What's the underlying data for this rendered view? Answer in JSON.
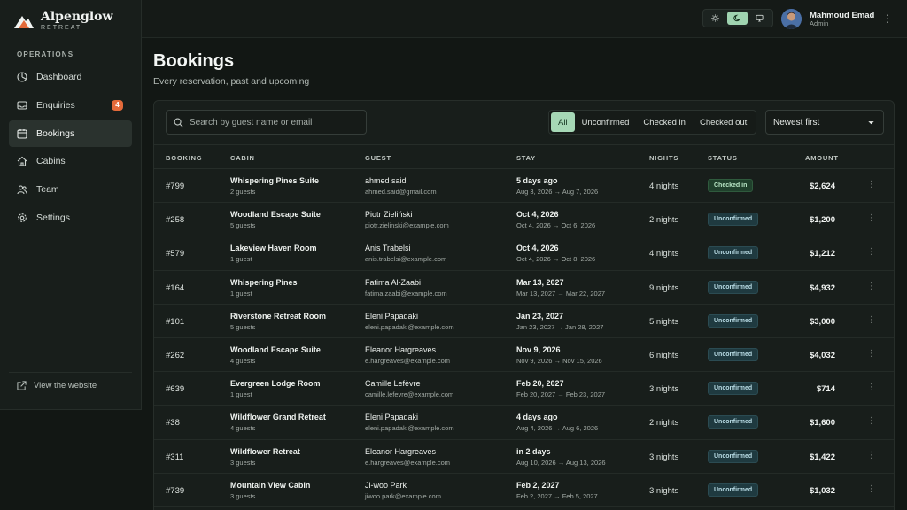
{
  "brand": {
    "name": "Alpenglow",
    "subtitle": "RETREAT"
  },
  "sidebar": {
    "section_label": "OPERATIONS",
    "items": [
      {
        "label": "Dashboard",
        "icon": "dashboard-icon"
      },
      {
        "label": "Enquiries",
        "icon": "inbox-icon",
        "badge": "4"
      },
      {
        "label": "Bookings",
        "icon": "calendar-icon",
        "active": true
      },
      {
        "label": "Cabins",
        "icon": "home-icon"
      },
      {
        "label": "Team",
        "icon": "users-icon"
      },
      {
        "label": "Settings",
        "icon": "gear-icon"
      }
    ],
    "view_site": "View the website"
  },
  "topbar": {
    "theme_options": [
      "sun-icon",
      "moon-icon",
      "monitor-icon"
    ],
    "theme_active": "moon-icon",
    "user_name": "Mahmoud Emad",
    "user_role": "Admin"
  },
  "page": {
    "title": "Bookings",
    "subtitle": "Every reservation, past and upcoming"
  },
  "toolbar": {
    "search_placeholder": "Search by guest name or email",
    "filters": [
      "All",
      "Unconfirmed",
      "Checked in",
      "Checked out"
    ],
    "active_filter": "All",
    "sort_value": "Newest first"
  },
  "table": {
    "headers": {
      "booking": "BOOKING",
      "cabin": "CABIN",
      "guest": "GUEST",
      "stay": "STAY",
      "nights": "NIGHTS",
      "status": "STATUS",
      "amount": "AMOUNT"
    },
    "rows": [
      {
        "id": "#799",
        "cabin": "Whispering Pines Suite",
        "guests": "2 guests",
        "guest_name": "ahmed said",
        "guest_email": "ahmed.said@gmail.com",
        "stay_main": "5 days ago",
        "stay_range": "Aug 3, 2026 → Aug 7, 2026",
        "nights": "4 nights",
        "status": "Checked in",
        "amount": "$2,624"
      },
      {
        "id": "#258",
        "cabin": "Woodland Escape Suite",
        "guests": "5 guests",
        "guest_name": "Piotr Zieliński",
        "guest_email": "piotr.zielinski@example.com",
        "stay_main": "Oct 4, 2026",
        "stay_range": "Oct 4, 2026 → Oct 6, 2026",
        "nights": "2 nights",
        "status": "Unconfirmed",
        "amount": "$1,200"
      },
      {
        "id": "#579",
        "cabin": "Lakeview Haven Room",
        "guests": "1 guest",
        "guest_name": "Anis Trabelsi",
        "guest_email": "anis.trabelsi@example.com",
        "stay_main": "Oct 4, 2026",
        "stay_range": "Oct 4, 2026 → Oct 8, 2026",
        "nights": "4 nights",
        "status": "Unconfirmed",
        "amount": "$1,212"
      },
      {
        "id": "#164",
        "cabin": "Whispering Pines",
        "guests": "1 guest",
        "guest_name": "Fatima Al-Zaabi",
        "guest_email": "fatima.zaabi@example.com",
        "stay_main": "Mar 13, 2027",
        "stay_range": "Mar 13, 2027 → Mar 22, 2027",
        "nights": "9 nights",
        "status": "Unconfirmed",
        "amount": "$4,932"
      },
      {
        "id": "#101",
        "cabin": "Riverstone Retreat Room",
        "guests": "5 guests",
        "guest_name": "Eleni Papadaki",
        "guest_email": "eleni.papadaki@example.com",
        "stay_main": "Jan 23, 2027",
        "stay_range": "Jan 23, 2027 → Jan 28, 2027",
        "nights": "5 nights",
        "status": "Unconfirmed",
        "amount": "$3,000"
      },
      {
        "id": "#262",
        "cabin": "Woodland Escape Suite",
        "guests": "4 guests",
        "guest_name": "Eleanor Hargreaves",
        "guest_email": "e.hargreaves@example.com",
        "stay_main": "Nov 9, 2026",
        "stay_range": "Nov 9, 2026 → Nov 15, 2026",
        "nights": "6 nights",
        "status": "Unconfirmed",
        "amount": "$4,032"
      },
      {
        "id": "#639",
        "cabin": "Evergreen Lodge Room",
        "guests": "1 guest",
        "guest_name": "Camille Lefèvre",
        "guest_email": "camille.lefevre@example.com",
        "stay_main": "Feb 20, 2027",
        "stay_range": "Feb 20, 2027 → Feb 23, 2027",
        "nights": "3 nights",
        "status": "Unconfirmed",
        "amount": "$714"
      },
      {
        "id": "#38",
        "cabin": "Wildflower Grand Retreat",
        "guests": "4 guests",
        "guest_name": "Eleni Papadaki",
        "guest_email": "eleni.papadaki@example.com",
        "stay_main": "4 days ago",
        "stay_range": "Aug 4, 2026 → Aug 6, 2026",
        "nights": "2 nights",
        "status": "Unconfirmed",
        "amount": "$1,600"
      },
      {
        "id": "#311",
        "cabin": "Wildflower Retreat",
        "guests": "3 guests",
        "guest_name": "Eleanor Hargreaves",
        "guest_email": "e.hargreaves@example.com",
        "stay_main": "in 2 days",
        "stay_range": "Aug 10, 2026 → Aug 13, 2026",
        "nights": "3 nights",
        "status": "Unconfirmed",
        "amount": "$1,422"
      },
      {
        "id": "#739",
        "cabin": "Mountain View Cabin",
        "guests": "3 guests",
        "guest_name": "Ji-woo Park",
        "guest_email": "jiwoo.park@example.com",
        "stay_main": "Feb 2, 2027",
        "stay_range": "Feb 2, 2027 → Feb 5, 2027",
        "nights": "3 nights",
        "status": "Unconfirmed",
        "amount": "$1,032"
      }
    ]
  },
  "colors": {
    "accent": "#a6d8b6",
    "badge": "#e36a3a",
    "background": "#121714"
  }
}
